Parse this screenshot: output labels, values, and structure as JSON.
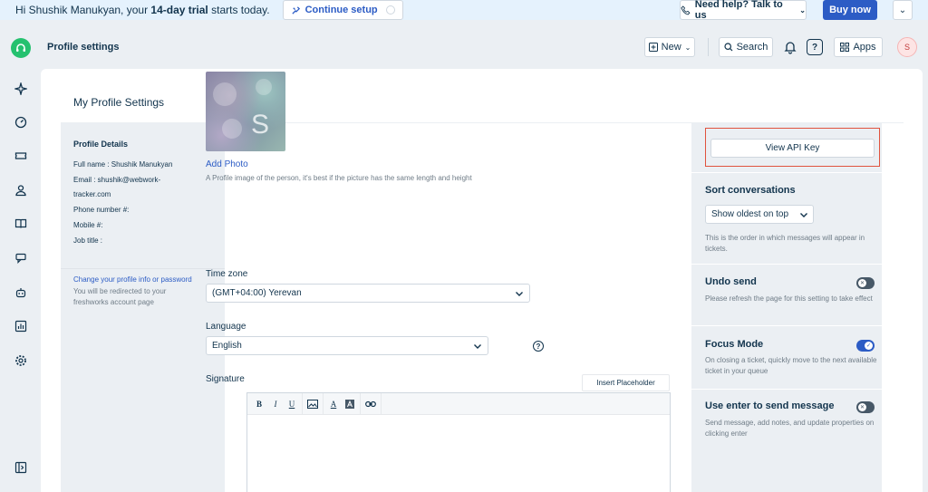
{
  "banner": {
    "greeting_prefix": "Hi Shushik Manukyan, your ",
    "trial_bold": "14-day trial",
    "greeting_suffix": " starts today.",
    "continue_setup": "Continue setup",
    "help": "Need help? Talk to us",
    "buy": "Buy now"
  },
  "header": {
    "title": "Profile settings",
    "new_label": "New",
    "search_label": "Search",
    "apps_label": "Apps",
    "avatar_initial": "S"
  },
  "page": {
    "title": "My Profile Settings"
  },
  "profile_details": {
    "section_title": "Profile Details",
    "full_name": "Full name : Shushik Manukyan",
    "email_line1": "Email : shushik@webwork-",
    "email_line2": "tracker.com",
    "phone": "Phone number #:",
    "mobile": "Mobile #:",
    "job_title": "Job title :",
    "change_link": "Change your profile info or password",
    "redirect_note": "You will be redirected to your freshworks account page"
  },
  "form": {
    "photo_initial": "S",
    "add_photo": "Add Photo",
    "photo_hint": "A Profile image of the person, it's best if the picture has the same length and height",
    "timezone_label": "Time zone",
    "timezone_value": "(GMT+04:00) Yerevan",
    "language_label": "Language",
    "language_value": "English",
    "signature_label": "Signature",
    "insert_placeholder": "Insert Placeholder",
    "toolbar": {
      "bold": "B",
      "italic": "I",
      "underline": "U",
      "font_color": "A"
    }
  },
  "settings": {
    "view_api_key": "View API Key",
    "sort": {
      "title": "Sort conversations",
      "value": "Show oldest on top",
      "desc": "This is the order in which messages will appear in tickets."
    },
    "undo_send": {
      "title": "Undo send",
      "desc": "Please refresh the page for this setting to take effect",
      "enabled": false
    },
    "focus_mode": {
      "title": "Focus Mode",
      "desc": "On closing a ticket, quickly move to the next available ticket in your queue",
      "enabled": true
    },
    "enter_send": {
      "title": "Use enter to send message",
      "desc": "Send message, add notes, and update properties on clicking enter",
      "enabled": false
    }
  },
  "colors": {
    "accent": "#2c5cc5",
    "highlight_border": "#e0533e",
    "logo_green": "#25c16f"
  }
}
